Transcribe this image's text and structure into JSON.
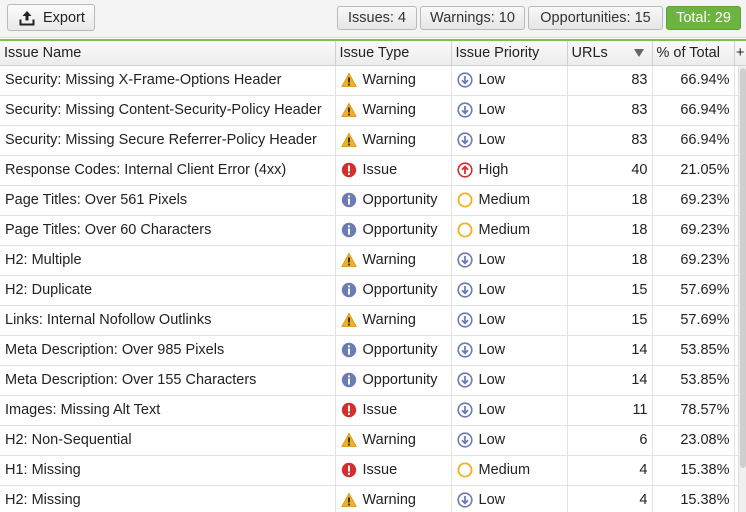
{
  "toolbar": {
    "export_label": "Export",
    "stats": [
      {
        "key": "issues",
        "label": "Issues: 4"
      },
      {
        "key": "warnings",
        "label": "Warnings: 10"
      },
      {
        "key": "opportunities",
        "label": "Opportunities: 15"
      },
      {
        "key": "total",
        "label": "Total: 29"
      }
    ]
  },
  "columns": {
    "name": "Issue Name",
    "type": "Issue Type",
    "priority": "Issue Priority",
    "urls": "URLs",
    "pct": "% of Total",
    "add": "+"
  },
  "colors": {
    "warning": "#f2b01e",
    "issue": "#d32f2f",
    "opportunity": "#6b7bb3",
    "low": "#6b7bb3",
    "high": "#d32f2f",
    "medium": "#f2b01e",
    "total_badge": "#6cb33f"
  },
  "rows": [
    {
      "name": "Security: Missing X-Frame-Options Header",
      "type": "Warning",
      "type_icon": "warning-icon",
      "priority": "Low",
      "priority_icon": "low-priority-icon",
      "urls": "83",
      "pct": "66.94%"
    },
    {
      "name": "Security: Missing Content-Security-Policy Header",
      "type": "Warning",
      "type_icon": "warning-icon",
      "priority": "Low",
      "priority_icon": "low-priority-icon",
      "urls": "83",
      "pct": "66.94%"
    },
    {
      "name": "Security: Missing Secure Referrer-Policy Header",
      "type": "Warning",
      "type_icon": "warning-icon",
      "priority": "Low",
      "priority_icon": "low-priority-icon",
      "urls": "83",
      "pct": "66.94%"
    },
    {
      "name": "Response Codes: Internal Client Error (4xx)",
      "type": "Issue",
      "type_icon": "issue-icon",
      "priority": "High",
      "priority_icon": "high-priority-icon",
      "urls": "40",
      "pct": "21.05%"
    },
    {
      "name": "Page Titles: Over 561 Pixels",
      "type": "Opportunity",
      "type_icon": "opportunity-icon",
      "priority": "Medium",
      "priority_icon": "medium-priority-icon",
      "urls": "18",
      "pct": "69.23%"
    },
    {
      "name": "Page Titles: Over 60 Characters",
      "type": "Opportunity",
      "type_icon": "opportunity-icon",
      "priority": "Medium",
      "priority_icon": "medium-priority-icon",
      "urls": "18",
      "pct": "69.23%"
    },
    {
      "name": "H2: Multiple",
      "type": "Warning",
      "type_icon": "warning-icon",
      "priority": "Low",
      "priority_icon": "low-priority-icon",
      "urls": "18",
      "pct": "69.23%"
    },
    {
      "name": "H2: Duplicate",
      "type": "Opportunity",
      "type_icon": "opportunity-icon",
      "priority": "Low",
      "priority_icon": "low-priority-icon",
      "urls": "15",
      "pct": "57.69%"
    },
    {
      "name": "Links: Internal Nofollow Outlinks",
      "type": "Warning",
      "type_icon": "warning-icon",
      "priority": "Low",
      "priority_icon": "low-priority-icon",
      "urls": "15",
      "pct": "57.69%"
    },
    {
      "name": "Meta Description: Over 985 Pixels",
      "type": "Opportunity",
      "type_icon": "opportunity-icon",
      "priority": "Low",
      "priority_icon": "low-priority-icon",
      "urls": "14",
      "pct": "53.85%"
    },
    {
      "name": "Meta Description: Over 155 Characters",
      "type": "Opportunity",
      "type_icon": "opportunity-icon",
      "priority": "Low",
      "priority_icon": "low-priority-icon",
      "urls": "14",
      "pct": "53.85%"
    },
    {
      "name": "Images: Missing Alt Text",
      "type": "Issue",
      "type_icon": "issue-icon",
      "priority": "Low",
      "priority_icon": "low-priority-icon",
      "urls": "11",
      "pct": "78.57%"
    },
    {
      "name": "H2: Non-Sequential",
      "type": "Warning",
      "type_icon": "warning-icon",
      "priority": "Low",
      "priority_icon": "low-priority-icon",
      "urls": "6",
      "pct": "23.08%"
    },
    {
      "name": "H1: Missing",
      "type": "Issue",
      "type_icon": "issue-icon",
      "priority": "Medium",
      "priority_icon": "medium-priority-icon",
      "urls": "4",
      "pct": "15.38%"
    },
    {
      "name": "H2: Missing",
      "type": "Warning",
      "type_icon": "warning-icon",
      "priority": "Low",
      "priority_icon": "low-priority-icon",
      "urls": "4",
      "pct": "15.38%"
    }
  ]
}
